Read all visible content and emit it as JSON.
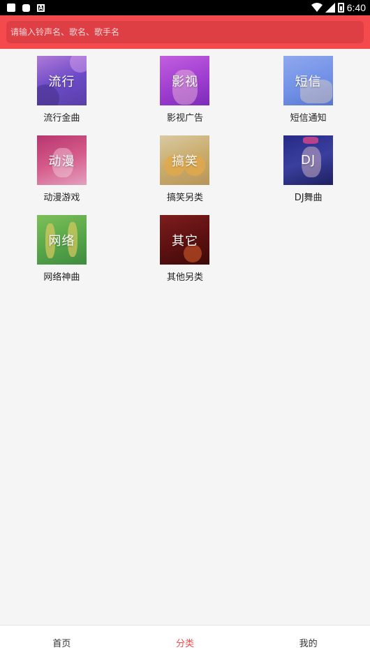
{
  "status_bar": {
    "time": "6:40",
    "left_icons": [
      "notification-square-icon",
      "notification-rounded-icon",
      "notification-a-icon"
    ],
    "right_icons": [
      "wifi-icon",
      "cell-signal-icon",
      "battery-icon"
    ]
  },
  "search": {
    "placeholder": "请输入铃声名、歌名、歌手名"
  },
  "categories": [
    {
      "overlay": "流行",
      "label": "流行金曲"
    },
    {
      "overlay": "影视",
      "label": "影视广告"
    },
    {
      "overlay": "短信",
      "label": "短信通知"
    },
    {
      "overlay": "动漫",
      "label": "动漫游戏"
    },
    {
      "overlay": "搞笑",
      "label": "搞笑另类"
    },
    {
      "overlay": "DJ",
      "label": "DJ舞曲"
    },
    {
      "overlay": "网络",
      "label": "网络神曲"
    },
    {
      "overlay": "其它",
      "label": "其他另类"
    }
  ],
  "bottom_nav": {
    "items": [
      {
        "label": "首页"
      },
      {
        "label": "分类"
      },
      {
        "label": "我的"
      }
    ],
    "active_index": 1
  },
  "colors": {
    "accent": "#f4494d",
    "search_box": "#de3f45",
    "background": "#f5f5f5"
  }
}
